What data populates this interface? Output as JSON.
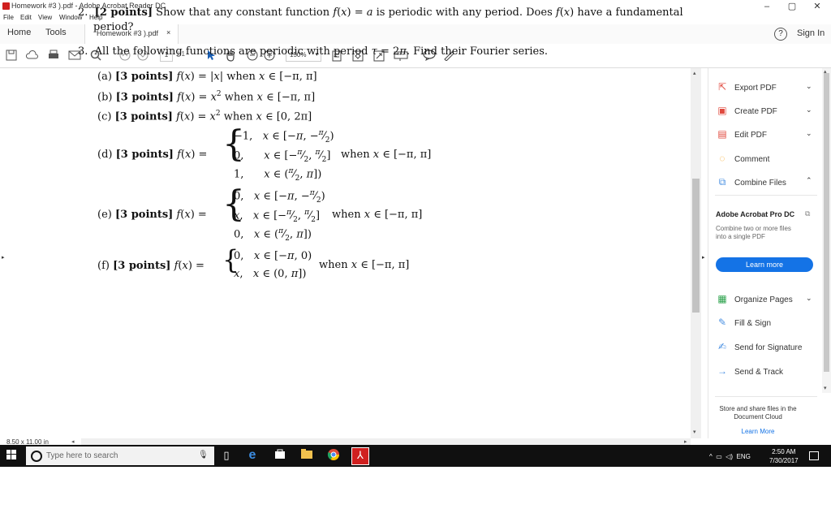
{
  "window": {
    "title": "Homework #3 ).pdf - Adobe Acrobat Reader DC",
    "controls": [
      "–",
      "▢",
      "✕"
    ]
  },
  "menu": [
    "File",
    "Edit",
    "View",
    "Window",
    "Help"
  ],
  "tabs": {
    "home": "Home",
    "tools": "Tools",
    "document": "Homework #3 ).pdf",
    "close": "×"
  },
  "header": {
    "help": "?",
    "signin": "Sign In"
  },
  "toolbar": {
    "page_current": "1",
    "page_total": "/ 1",
    "zoom": "150%"
  },
  "document": {
    "p2_label": "2.",
    "p2_points": "[2 points]",
    "p2_text_a": "Show that any constant function",
    "p2_text_b": "is periodic with any period. Does",
    "p2_text_c": "have a fundamental",
    "p2_text_d": "period?",
    "p3_label": "3.",
    "p3_text": "All the following functions are periodic with period",
    "p3_text_b": "Find their Fourier series.",
    "items": [
      {
        "label": "(a)",
        "points": "[3 points]",
        "cond": "when",
        "dom": "[−π, π]"
      },
      {
        "label": "(b)",
        "points": "[3 points]",
        "cond": "when",
        "dom": "[−π, π]"
      },
      {
        "label": "(c)",
        "points": "[3 points]",
        "cond": "when",
        "dom": "[0, 2π]"
      },
      {
        "label": "(d)",
        "points": "[3 points]",
        "cond": "when",
        "dom": "[−π, π]"
      },
      {
        "label": "(e)",
        "points": "[3 points]",
        "cond": "when",
        "dom": "[−π, π]"
      },
      {
        "label": "(f)",
        "points": "[3 points]",
        "cond": "when",
        "dom": "[−π, π]"
      }
    ],
    "page_size": "8.50 x 11.00 in"
  },
  "right_pane": {
    "tools": [
      {
        "label": "Export PDF",
        "icon": "export-pdf-icon",
        "color": "#e04a3f",
        "chevron": "⌄"
      },
      {
        "label": "Create PDF",
        "icon": "create-pdf-icon",
        "color": "#e04a3f",
        "chevron": "⌄"
      },
      {
        "label": "Edit PDF",
        "icon": "edit-pdf-icon",
        "color": "#e04a3f",
        "chevron": "⌄"
      },
      {
        "label": "Comment",
        "icon": "comment-icon",
        "color": "#f5a623",
        "chevron": ""
      },
      {
        "label": "Combine Files",
        "icon": "combine-files-icon",
        "color": "#4a90e2",
        "chevron": "⌃"
      }
    ],
    "promo": {
      "title": "Adobe Acrobat Pro DC",
      "desc": "Combine two or more files into a single PDF",
      "button": "Learn more"
    },
    "tools2": [
      {
        "label": "Organize Pages",
        "icon": "organize-pages-icon",
        "color": "#2ca24c",
        "chevron": "⌄"
      },
      {
        "label": "Fill & Sign",
        "icon": "fill-sign-icon",
        "color": "#4a90e2",
        "chevron": ""
      },
      {
        "label": "Send for Signature",
        "icon": "send-signature-icon",
        "color": "#4a90e2",
        "chevron": ""
      },
      {
        "label": "Send & Track",
        "icon": "send-track-icon",
        "color": "#4a90e2",
        "chevron": ""
      }
    ],
    "cloud_text": "Store and share files in the Document Cloud",
    "cloud_link": "Learn More"
  },
  "taskbar": {
    "search_placeholder": "Type here to search",
    "language": "ENG",
    "time": "2:50 AM",
    "date": "7/30/2017"
  },
  "colors": {
    "accent": "#1473e6",
    "taskbar": "#101010",
    "acrobat_red": "#d0201f"
  }
}
